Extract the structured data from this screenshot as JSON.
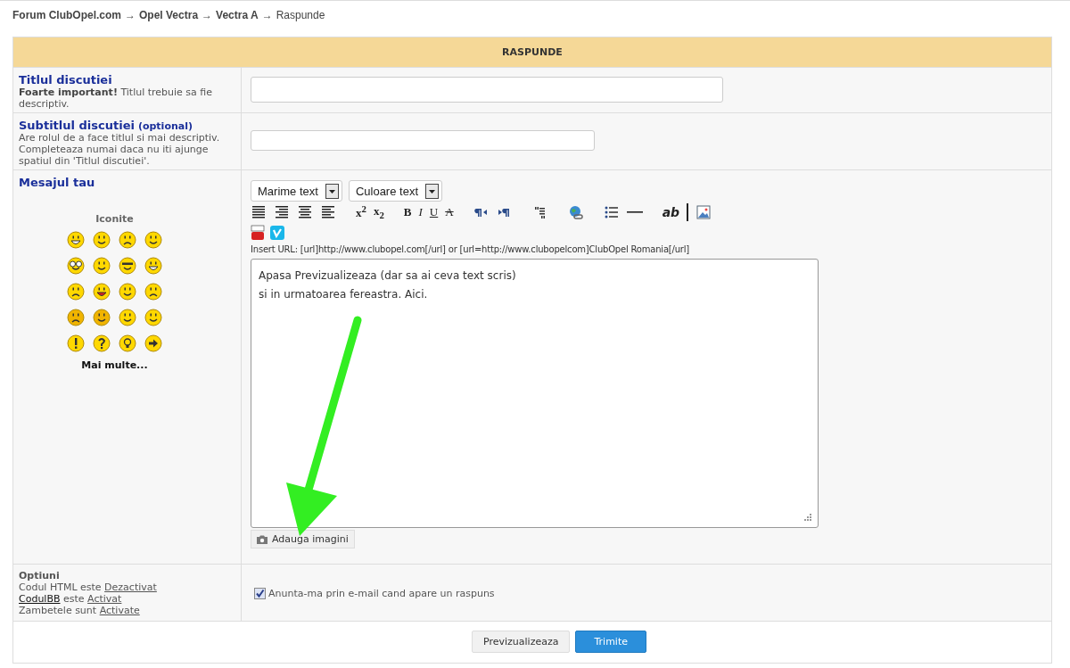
{
  "breadcrumb": [
    {
      "label": "Forum ClubOpel.com",
      "current": false
    },
    {
      "label": "Opel Vectra",
      "current": false
    },
    {
      "label": "Vectra A",
      "current": false
    },
    {
      "label": "Raspunde",
      "current": true
    }
  ],
  "breadcrumb_separator": "→",
  "form_title": "RASPUNDE",
  "title_row": {
    "label": "Titlul discutiei",
    "hint": "**Foarte important!** Titlul trebuie sa fie descriptiv."
  },
  "subtitle_row": {
    "label": "Subtitlul discutiei",
    "tag": "(optional)",
    "hint": "Are rolul de a face titlul si mai descriptiv. Completeaza numai daca nu iti ajunge spatiul din 'Titlul discutiei'."
  },
  "message_row": {
    "label": "Mesajul tau",
    "smilies_title": "Iconite",
    "more": "Mai multe..."
  },
  "selects": [
    {
      "label": "Marime text"
    },
    {
      "label": "Culoare text"
    }
  ],
  "toolbar": [
    {
      "kind": "justify"
    },
    {
      "kind": "align-right"
    },
    {
      "kind": "align-center"
    },
    {
      "kind": "align-left"
    },
    {
      "kind": "sep"
    },
    {
      "kind": "char",
      "label": "x$^{2}$"
    },
    {
      "kind": "char",
      "label": "x$_{2}$"
    },
    {
      "kind": "sep"
    },
    {
      "kind": "char",
      "label": "B"
    },
    {
      "kind": "char",
      "label": "I"
    },
    {
      "kind": "char",
      "label": "U"
    },
    {
      "kind": "char",
      "label": "A"
    },
    {
      "kind": "sep"
    },
    {
      "kind": "rtl"
    },
    {
      "kind": "ltr"
    },
    {
      "kind": "sep"
    },
    {
      "kind": "quote"
    },
    {
      "kind": "sep"
    },
    {
      "kind": "globe"
    },
    {
      "kind": "sep"
    },
    {
      "kind": "list"
    },
    {
      "kind": "rule"
    },
    {
      "kind": "sep"
    },
    {
      "kind": "char",
      "label": "ab"
    },
    {
      "kind": "bar"
    },
    {
      "kind": "image"
    }
  ],
  "media_buttons": [
    {
      "kind": "tube"
    },
    {
      "kind": "vimeo"
    }
  ],
  "url_hint": "Insert URL: [url]http://www.clubopel.com[/url] or [url=http://www.clubopelcom]ClubOpel Romania[/url]",
  "message": "Apasa Previzualizeaza (dar sa ai ceva text scris)\nsi in urmatoarea fereastra. Aici.",
  "add_images": "Adauga imagini",
  "options": {
    "title": "Optiuni",
    "lines": [
      [
        {
          "text": "Codul HTML este "
        },
        {
          "link": "Dezactivat"
        }
      ],
      [
        {
          "link": "CodulBB",
          "strong": true
        },
        {
          "text": " este "
        },
        {
          "link": "Activat"
        }
      ],
      [
        {
          "text": "Zambetele sunt "
        },
        {
          "link": "Activate"
        }
      ]
    ]
  },
  "notify": {
    "label": "Anunta-ma prin e-mail cand apare un raspuns",
    "checked": true
  },
  "buttons": [
    {
      "label": "Previzualizeaza",
      "kind": "secondary"
    },
    {
      "label": "Trimite",
      "kind": "primary"
    }
  ]
}
